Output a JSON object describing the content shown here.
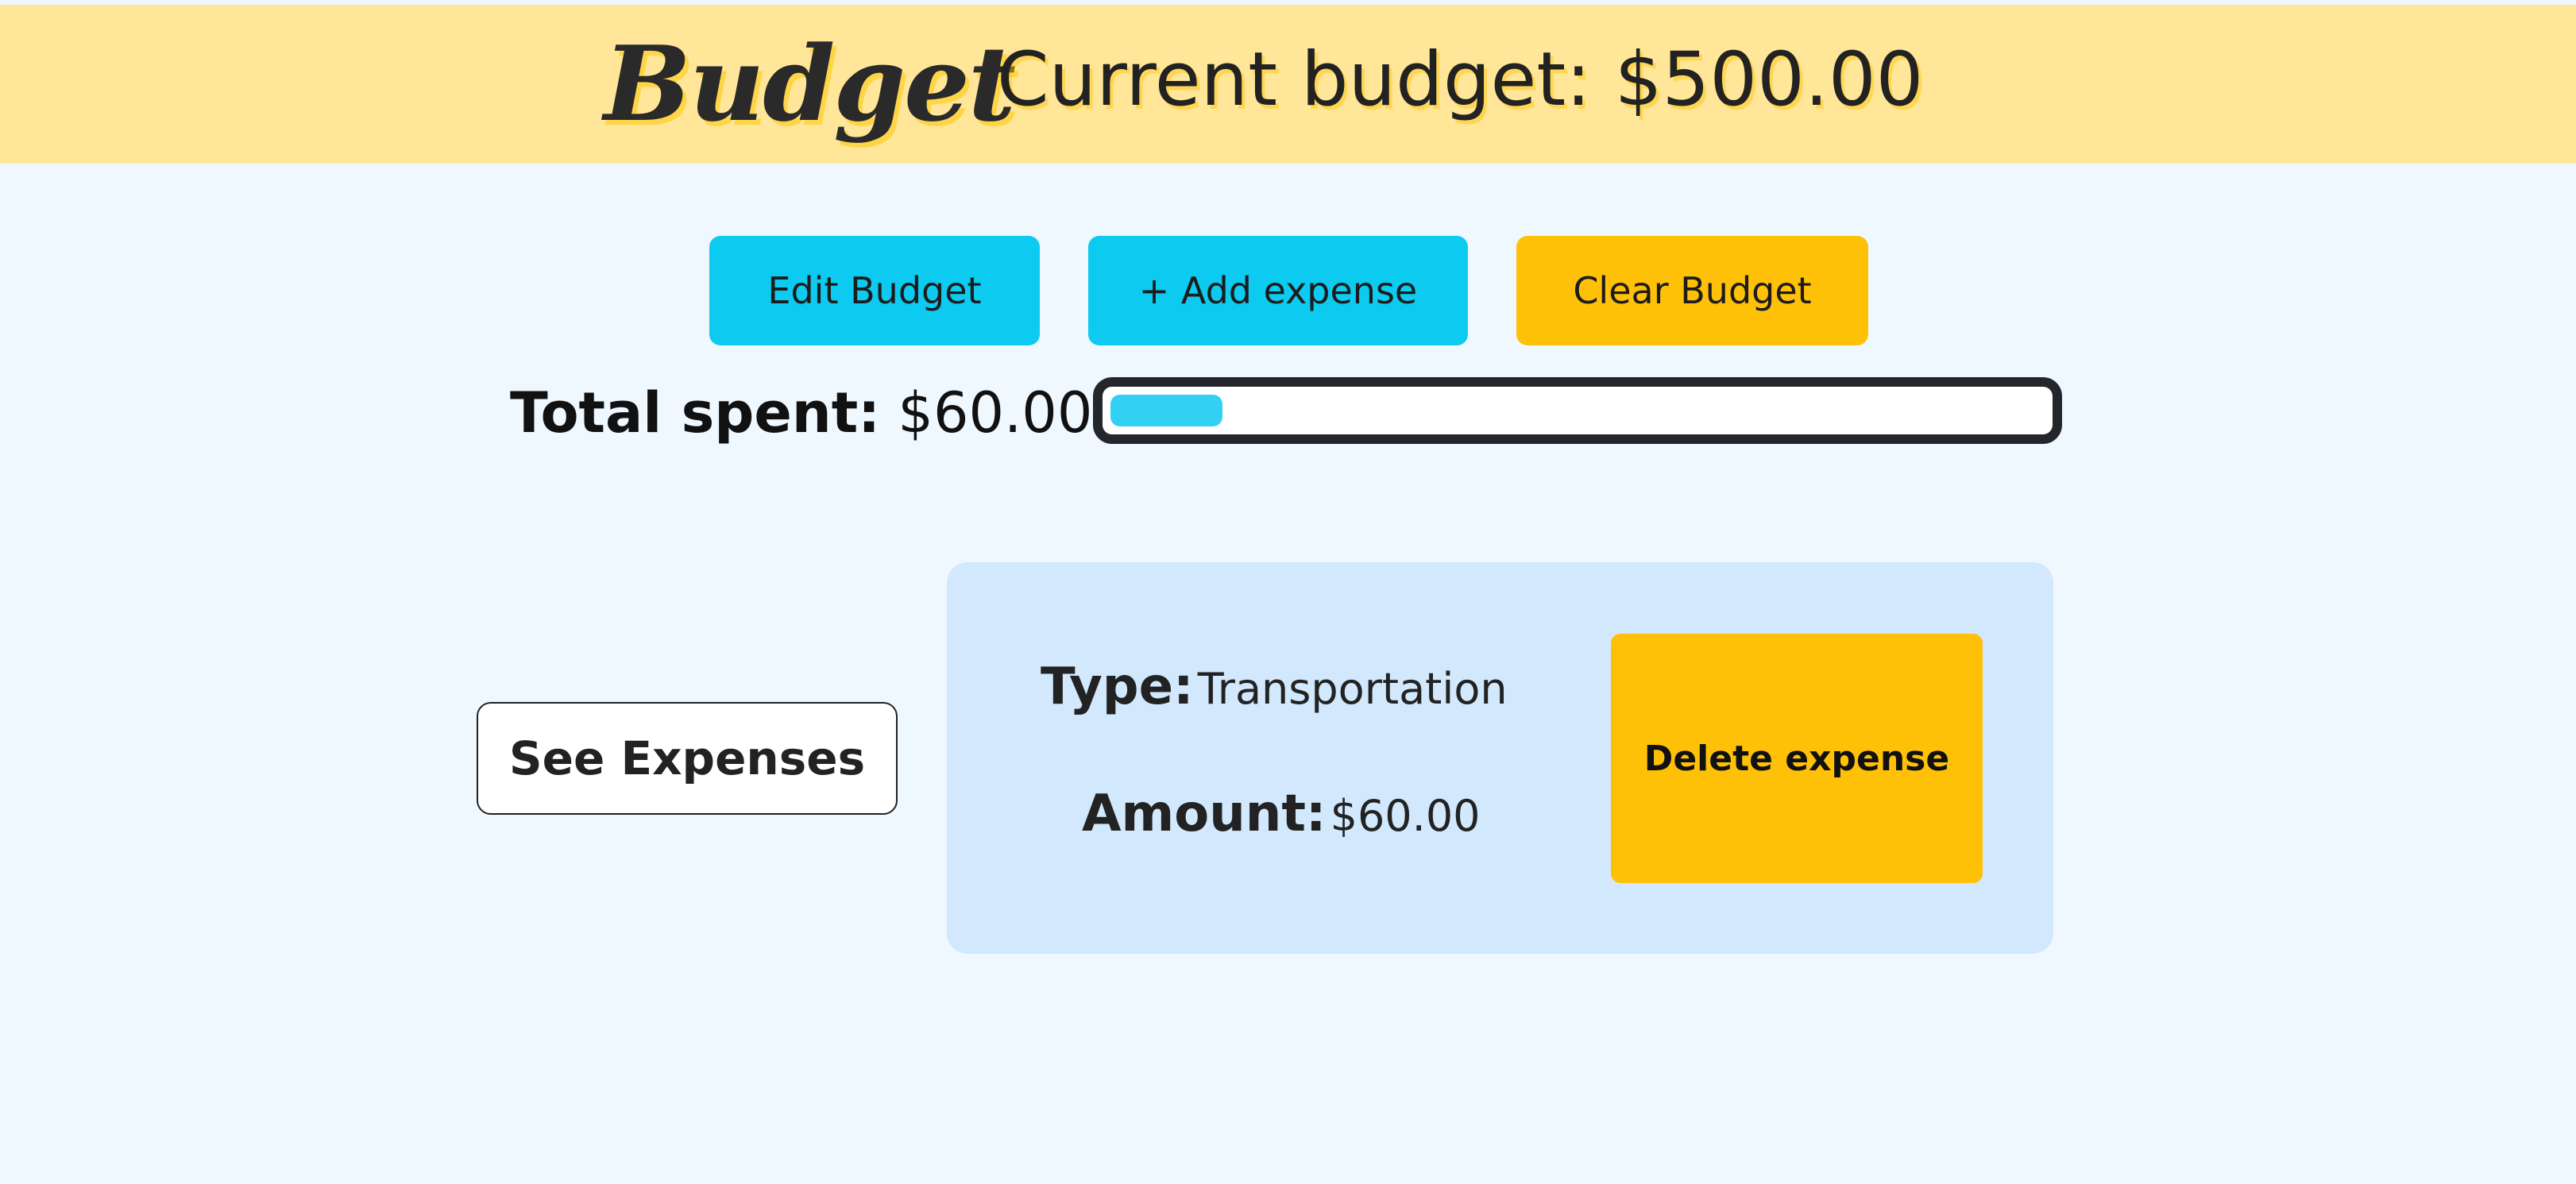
{
  "header": {
    "brand": "Budget",
    "current_budget": "Current budget: $500.00"
  },
  "actions": {
    "edit_budget": "Edit Budget",
    "add_expense": "+ Add expense",
    "clear_budget": "Clear Budget"
  },
  "summary": {
    "total_label": "Total spent:",
    "total_value": "$60.00",
    "progress_fraction": 0.12
  },
  "expenses": {
    "see_label": "See Expenses",
    "items": [
      {
        "type_label": "Type:",
        "type_value": "Transportation",
        "amount_label": "Amount:",
        "amount_value": "$60.00",
        "delete_label": "Delete expense"
      }
    ]
  },
  "colors": {
    "header_bg": "#ffe699",
    "page_bg": "#eff7ff",
    "primary": "#0ccaf0",
    "warning": "#ffc107",
    "card_bg": "#d2e8fd",
    "progress_fill": "#32d0f2"
  }
}
